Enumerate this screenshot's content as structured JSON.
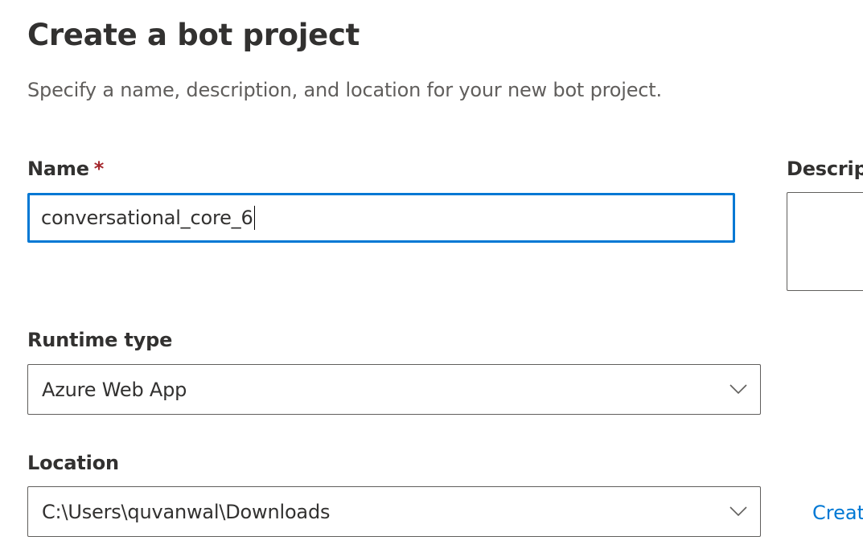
{
  "dialog": {
    "title": "Create a bot project",
    "subtitle": "Specify a name, description, and location for your new bot project."
  },
  "name_field": {
    "label": "Name",
    "required_marker": "*",
    "value": "conversational_core_6"
  },
  "description_field": {
    "label": "Descrip"
  },
  "runtime_field": {
    "label": "Runtime type",
    "selected": "Azure Web App",
    "icon": "chevron-down-icon"
  },
  "location_field": {
    "label": "Location",
    "selected": "C:\\Users\\quvanwal\\Downloads",
    "icon": "chevron-down-icon",
    "create_link": "Creat"
  },
  "colors": {
    "focus_border": "#0078d4",
    "link": "#0078d4",
    "required": "#a4262c",
    "text": "#323130",
    "secondary_text": "#605e5c"
  }
}
